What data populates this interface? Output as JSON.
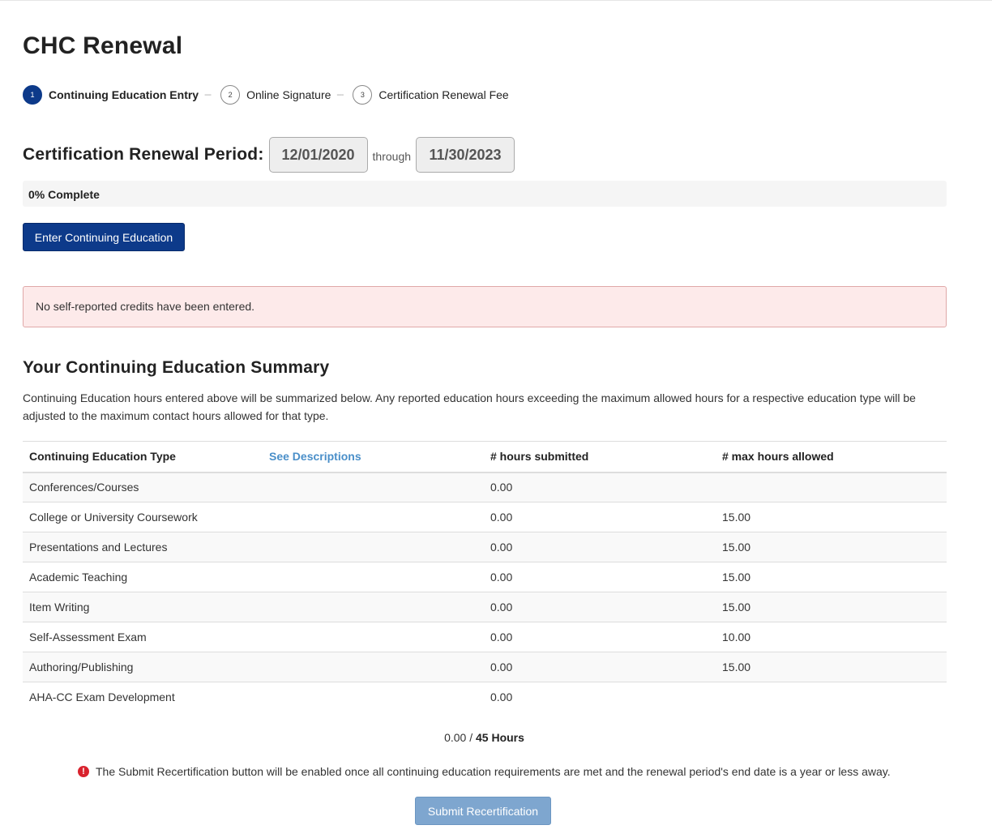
{
  "page": {
    "title": "CHC Renewal"
  },
  "steps": [
    {
      "number": "1",
      "label": "Continuing Education Entry",
      "active": true
    },
    {
      "number": "2",
      "label": "Online Signature",
      "active": false
    },
    {
      "number": "3",
      "label": "Certification Renewal Fee",
      "active": false
    }
  ],
  "step_separator": "---",
  "period": {
    "label": "Certification Renewal Period:",
    "start": "12/01/2020",
    "through": "through",
    "end": "11/30/2023"
  },
  "progress": {
    "text": "0% Complete",
    "percent": 0,
    "fill_color": "#0d3a8a"
  },
  "actions": {
    "enter_ce_label": "Enter Continuing Education"
  },
  "alert": {
    "message": "No self-reported credits have been entered.",
    "background": "#fdeaea"
  },
  "summary": {
    "title": "Your Continuing Education Summary",
    "description": "Continuing Education hours entered above will be summarized below. Any reported education hours exceeding the maximum allowed hours for a respective education type will be adjusted to the maximum contact hours allowed for that type.",
    "table": {
      "headers": {
        "type": "Continuing Education Type",
        "see_descriptions": "See Descriptions",
        "submitted": "# hours submitted",
        "max": "# max hours allowed"
      },
      "rows": [
        {
          "type": "Conferences/Courses",
          "submitted": "0.00",
          "max": ""
        },
        {
          "type": "College or University Coursework",
          "submitted": "0.00",
          "max": "15.00"
        },
        {
          "type": "Presentations and Lectures",
          "submitted": "0.00",
          "max": "15.00"
        },
        {
          "type": "Academic Teaching",
          "submitted": "0.00",
          "max": "15.00"
        },
        {
          "type": "Item Writing",
          "submitted": "0.00",
          "max": "15.00"
        },
        {
          "type": "Self-Assessment Exam",
          "submitted": "0.00",
          "max": "10.00"
        },
        {
          "type": "Authoring/Publishing",
          "submitted": "0.00",
          "max": "15.00"
        },
        {
          "type": "AHA-CC Exam Development",
          "submitted": "0.00",
          "max": ""
        }
      ]
    },
    "totals": {
      "submitted": "0.00",
      "separator": "/",
      "required": "45 Hours"
    }
  },
  "notice": {
    "icon": "exclamation-circle-icon",
    "icon_glyph": "!",
    "text": "The Submit Recertification button will be enabled once all continuing education requirements are met and the renewal period's end date is a year or less away."
  },
  "submit": {
    "label": "Submit Recertification",
    "enabled": false
  }
}
